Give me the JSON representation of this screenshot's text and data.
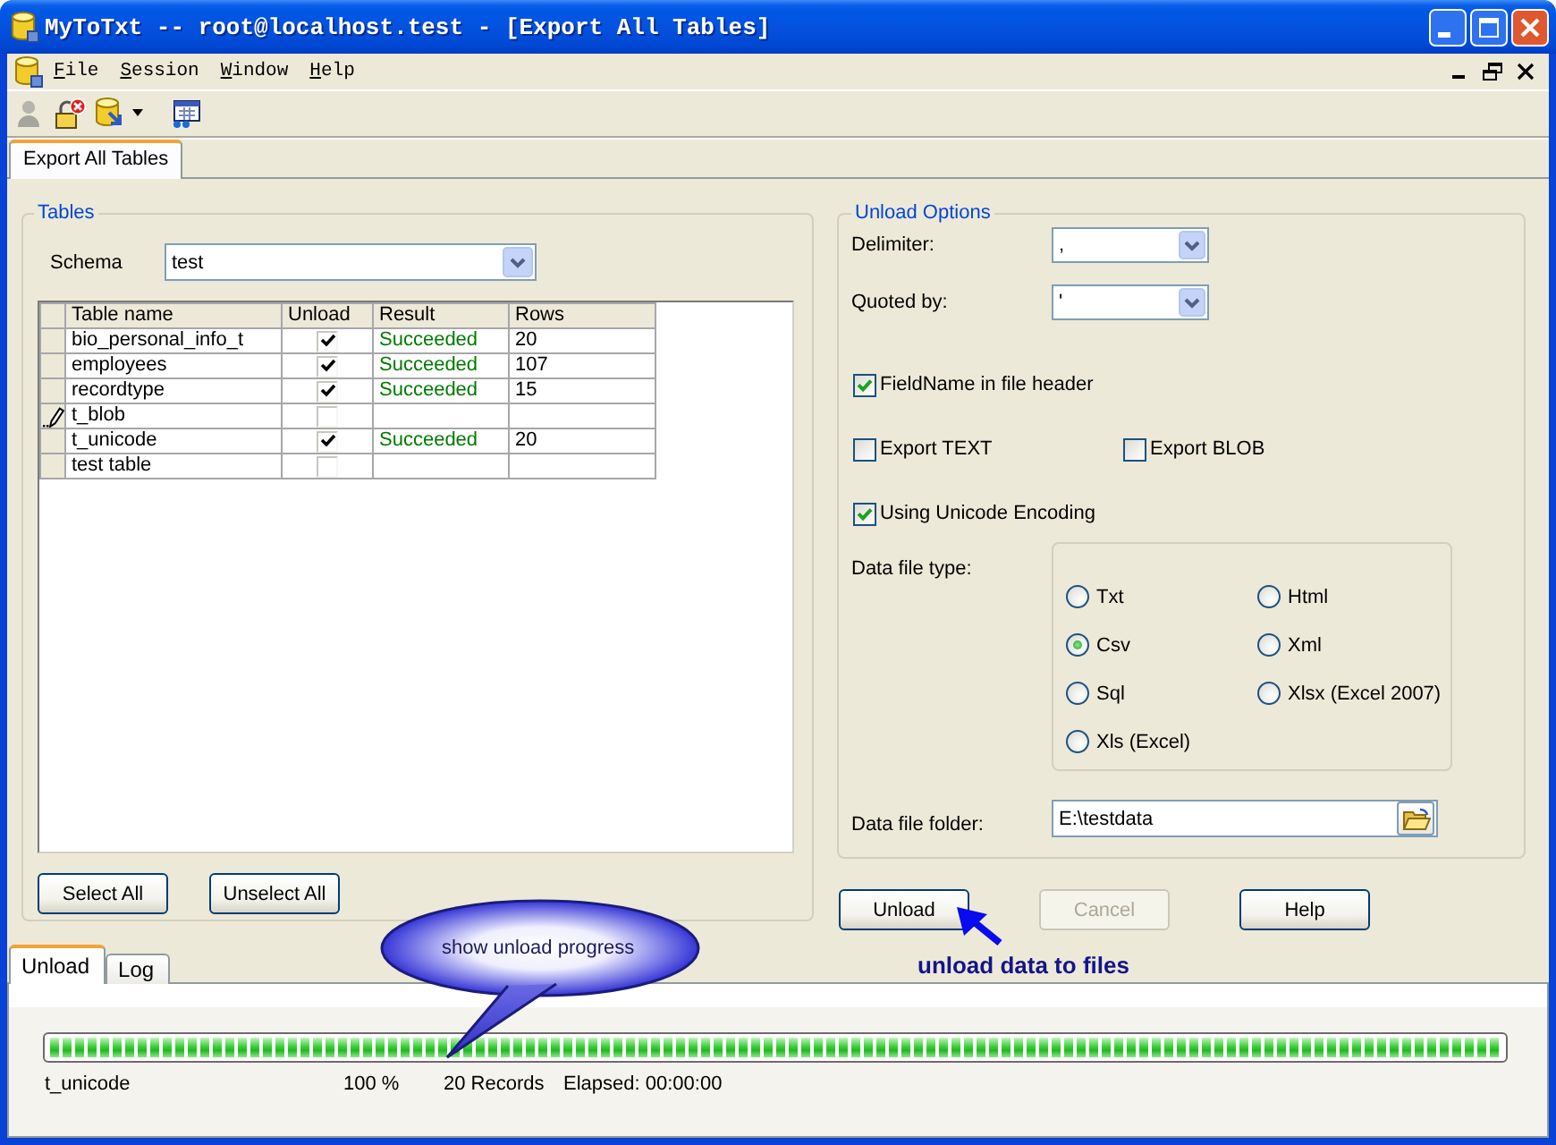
{
  "window": {
    "title": "MyToTxt -- root@localhost.test - [Export All Tables]"
  },
  "menu": [
    "File",
    "Session",
    "Window",
    "Help"
  ],
  "toolbar": [
    {
      "disabled": true
    },
    {
      "disabled": false
    },
    {
      "disabled": false
    },
    {
      "disabled": false
    }
  ],
  "document_tabs": [
    {
      "label": "Export All Tables",
      "selected": true
    }
  ],
  "tables": {
    "title": "Tables",
    "schema": {
      "label": "Schema",
      "value": "test"
    },
    "columns": [
      "Table name",
      "Unload",
      "Result",
      "Rows"
    ],
    "rows": [
      {
        "editing": false,
        "name": "bio_personal_info_t",
        "unload": true,
        "result": "Succeeded",
        "rows": "20"
      },
      {
        "editing": false,
        "name": "employees",
        "unload": true,
        "result": "Succeeded",
        "rows": "107"
      },
      {
        "editing": false,
        "name": "recordtype",
        "unload": true,
        "result": "Succeeded",
        "rows": "15"
      },
      {
        "editing": true,
        "name": "t_blob",
        "unload": false
      },
      {
        "editing": false,
        "name": "t_unicode",
        "unload": true,
        "result": "Succeeded",
        "rows": "20"
      },
      {
        "editing": false,
        "name": "test table",
        "unload": false
      }
    ],
    "buttons": [
      "Select All",
      "Unselect All"
    ]
  },
  "unload_options": {
    "title": "Unload Options",
    "delimiter": {
      "label": "Delimiter:",
      "value": ","
    },
    "quoted_by": {
      "label": "Quoted by:",
      "value": "'"
    },
    "checkbox_rows": [
      [
        {
          "label": "FieldName in file header",
          "checked": true
        }
      ],
      [
        {
          "label": "Export TEXT",
          "checked": false
        },
        {
          "label": "Export BLOB",
          "checked": false
        }
      ],
      [
        {
          "label": "Using Unicode Encoding",
          "checked": true
        }
      ]
    ],
    "file_type": {
      "label": "Data file type:",
      "options": [
        {
          "label": "Txt",
          "selected": false
        },
        {
          "label": "Html",
          "selected": false
        },
        {
          "label": "Csv",
          "selected": true
        },
        {
          "label": "Xml",
          "selected": false
        },
        {
          "label": "Sql",
          "selected": false
        },
        {
          "label": "Xlsx (Excel 2007)",
          "selected": false
        },
        {
          "label": "Xls (Excel)",
          "selected": false
        }
      ]
    },
    "folder": {
      "label": "Data file folder:",
      "value": "E:\\testdata"
    }
  },
  "action_buttons": [
    {
      "label": "Unload",
      "disabled": false
    },
    {
      "label": "Cancel",
      "disabled": true
    },
    {
      "label": "Help",
      "disabled": false
    }
  ],
  "progress_tabs": [
    {
      "label": "Unload",
      "selected": true
    },
    {
      "label": "Log",
      "selected": false
    }
  ],
  "progress": {
    "level": 1,
    "table": "t_unicode",
    "percent": "100 %",
    "records": "20 Records",
    "elapsed": "Elapsed: 00:00:00"
  },
  "annotations": [
    {
      "kind": "callout",
      "text": "show unload progress"
    },
    {
      "kind": "arrow_note",
      "text": "unload data to files"
    }
  ]
}
